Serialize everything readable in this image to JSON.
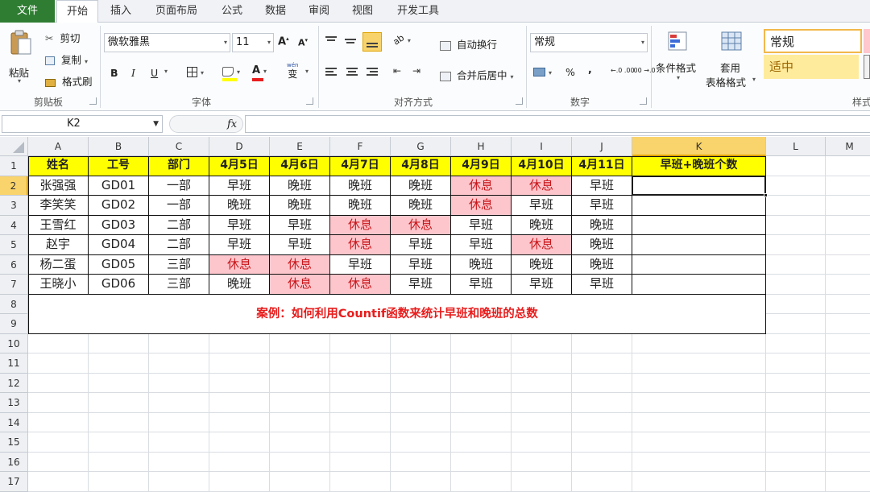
{
  "tabs": [
    "文件",
    "开始",
    "插入",
    "页面布局",
    "公式",
    "数据",
    "审阅",
    "视图",
    "开发工具"
  ],
  "active_tab": "开始",
  "ribbon": {
    "clipboard": {
      "paste": "粘贴",
      "cut": "剪切",
      "copy": "复制",
      "format_painter": "格式刷",
      "label": "剪贴板"
    },
    "font": {
      "name": "微软雅黑",
      "size": "11",
      "bold": "B",
      "italic": "I",
      "underline": "U",
      "label": "字体",
      "wen": "wén",
      "wen_sub": "变"
    },
    "alignment": {
      "wrap": "自动换行",
      "merge": "合并后居中",
      "label": "对齐方式"
    },
    "number": {
      "format": "常规",
      "percent": "%",
      "comma": ",",
      "inc_decimal": "←.0 .00",
      "dec_decimal": ".00 →.0",
      "label": "数字"
    },
    "styles": {
      "conditional": "条件格式",
      "table_format_1": "套用",
      "table_format_2": "表格格式",
      "normal": "常规",
      "neutral": "适中",
      "label": "样式"
    }
  },
  "formula_bar": {
    "name_box": "K2",
    "fx": "fx",
    "value": ""
  },
  "columns": [
    "A",
    "B",
    "C",
    "D",
    "E",
    "F",
    "G",
    "H",
    "I",
    "J",
    "K",
    "L",
    "M"
  ],
  "rows": [
    "1",
    "2",
    "3",
    "4",
    "5",
    "6",
    "7",
    "8",
    "9",
    "10",
    "11",
    "12",
    "13",
    "14",
    "15",
    "16",
    "17"
  ],
  "selected_col": "K",
  "selected_row": "2",
  "table": {
    "headers": [
      "姓名",
      "工号",
      "部门",
      "4月5日",
      "4月6日",
      "4月7日",
      "4月8日",
      "4月9日",
      "4月10日",
      "4月11日",
      "早班+晚班个数"
    ],
    "rows": [
      [
        "张强强",
        "GD01",
        "一部",
        "早班",
        "晚班",
        "晚班",
        "晚班",
        "休息",
        "休息",
        "早班",
        ""
      ],
      [
        "李笑笑",
        "GD02",
        "一部",
        "晚班",
        "晚班",
        "晚班",
        "晚班",
        "休息",
        "早班",
        "早班",
        ""
      ],
      [
        "王雪红",
        "GD03",
        "二部",
        "早班",
        "早班",
        "休息",
        "休息",
        "早班",
        "晚班",
        "晚班",
        ""
      ],
      [
        "赵宇",
        "GD04",
        "二部",
        "早班",
        "早班",
        "休息",
        "早班",
        "早班",
        "休息",
        "晚班",
        ""
      ],
      [
        "杨二蛋",
        "GD05",
        "三部",
        "休息",
        "休息",
        "早班",
        "早班",
        "晚班",
        "晚班",
        "晚班",
        ""
      ],
      [
        "王晓小",
        "GD06",
        "三部",
        "晚班",
        "休息",
        "休息",
        "早班",
        "早班",
        "早班",
        "早班",
        ""
      ]
    ]
  },
  "note": "案例：如何利用Countif函数来统计早班和晚班的总数",
  "colors": {
    "header_fill": "#ffff00",
    "rest_fill": "#fcc6cc",
    "rest_text": "#c9161b",
    "note_text": "#e81c1c",
    "file_tab": "#2f7d32"
  }
}
